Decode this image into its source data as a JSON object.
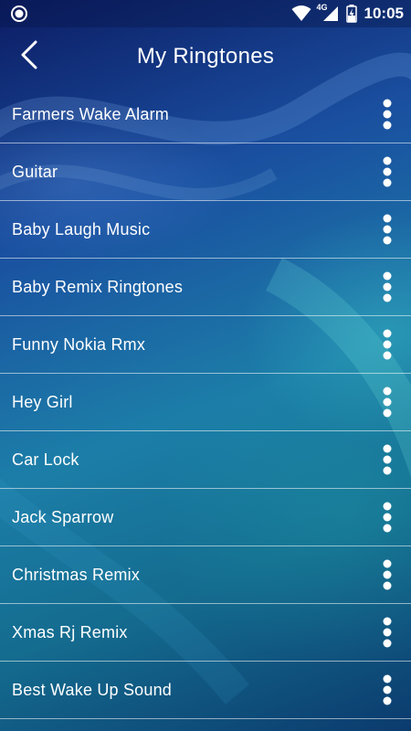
{
  "status_bar": {
    "network": "4G",
    "time": "10:05",
    "icons": [
      "record-icon",
      "wifi-icon",
      "signal-icon",
      "battery-charging-icon"
    ]
  },
  "app_bar": {
    "title": "My Ringtones",
    "back_icon": "back-arrow-icon"
  },
  "ringtones": [
    {
      "label": "Farmers Wake Alarm"
    },
    {
      "label": "Guitar"
    },
    {
      "label": "Baby Laugh Music"
    },
    {
      "label": "Baby Remix Ringtones"
    },
    {
      "label": "Funny Nokia Rmx"
    },
    {
      "label": "Hey Girl"
    },
    {
      "label": "Car Lock"
    },
    {
      "label": "Jack Sparrow"
    },
    {
      "label": "Christmas Remix"
    },
    {
      "label": "Xmas Rj Remix"
    },
    {
      "label": "Best Wake Up Sound"
    }
  ],
  "row_menu_icon": "more-vertical-icon"
}
